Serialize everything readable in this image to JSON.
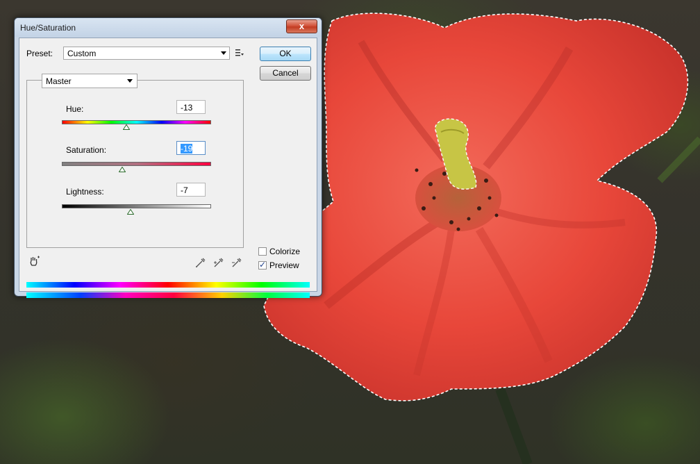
{
  "dialog": {
    "title": "Hue/Saturation",
    "close_glyph": "x",
    "preset_label": "Preset:",
    "preset_value": "Custom",
    "ok_label": "OK",
    "cancel_label": "Cancel",
    "channel_value": "Master",
    "sliders": [
      {
        "label": "Hue:",
        "value": "-13"
      },
      {
        "label": "Saturation:",
        "value": "-19"
      },
      {
        "label": "Lightness:",
        "value": "-7"
      }
    ],
    "colorize_label": "Colorize",
    "colorize_checked": false,
    "preview_label": "Preview",
    "preview_checked": true,
    "check_glyph": "✓"
  },
  "icons": {
    "preset_menu": "preset-options-icon",
    "targeted_adjustment": "hand-adjust-icon",
    "eyedroppers": [
      "eyedropper-icon",
      "eyedropper-plus-icon",
      "eyedropper-minus-icon"
    ]
  },
  "colors": {
    "ok_border": "#3c7fb1",
    "close_red": "#c33c22",
    "selection_blue": "#3399ff",
    "flower_red": "#e8473a"
  }
}
